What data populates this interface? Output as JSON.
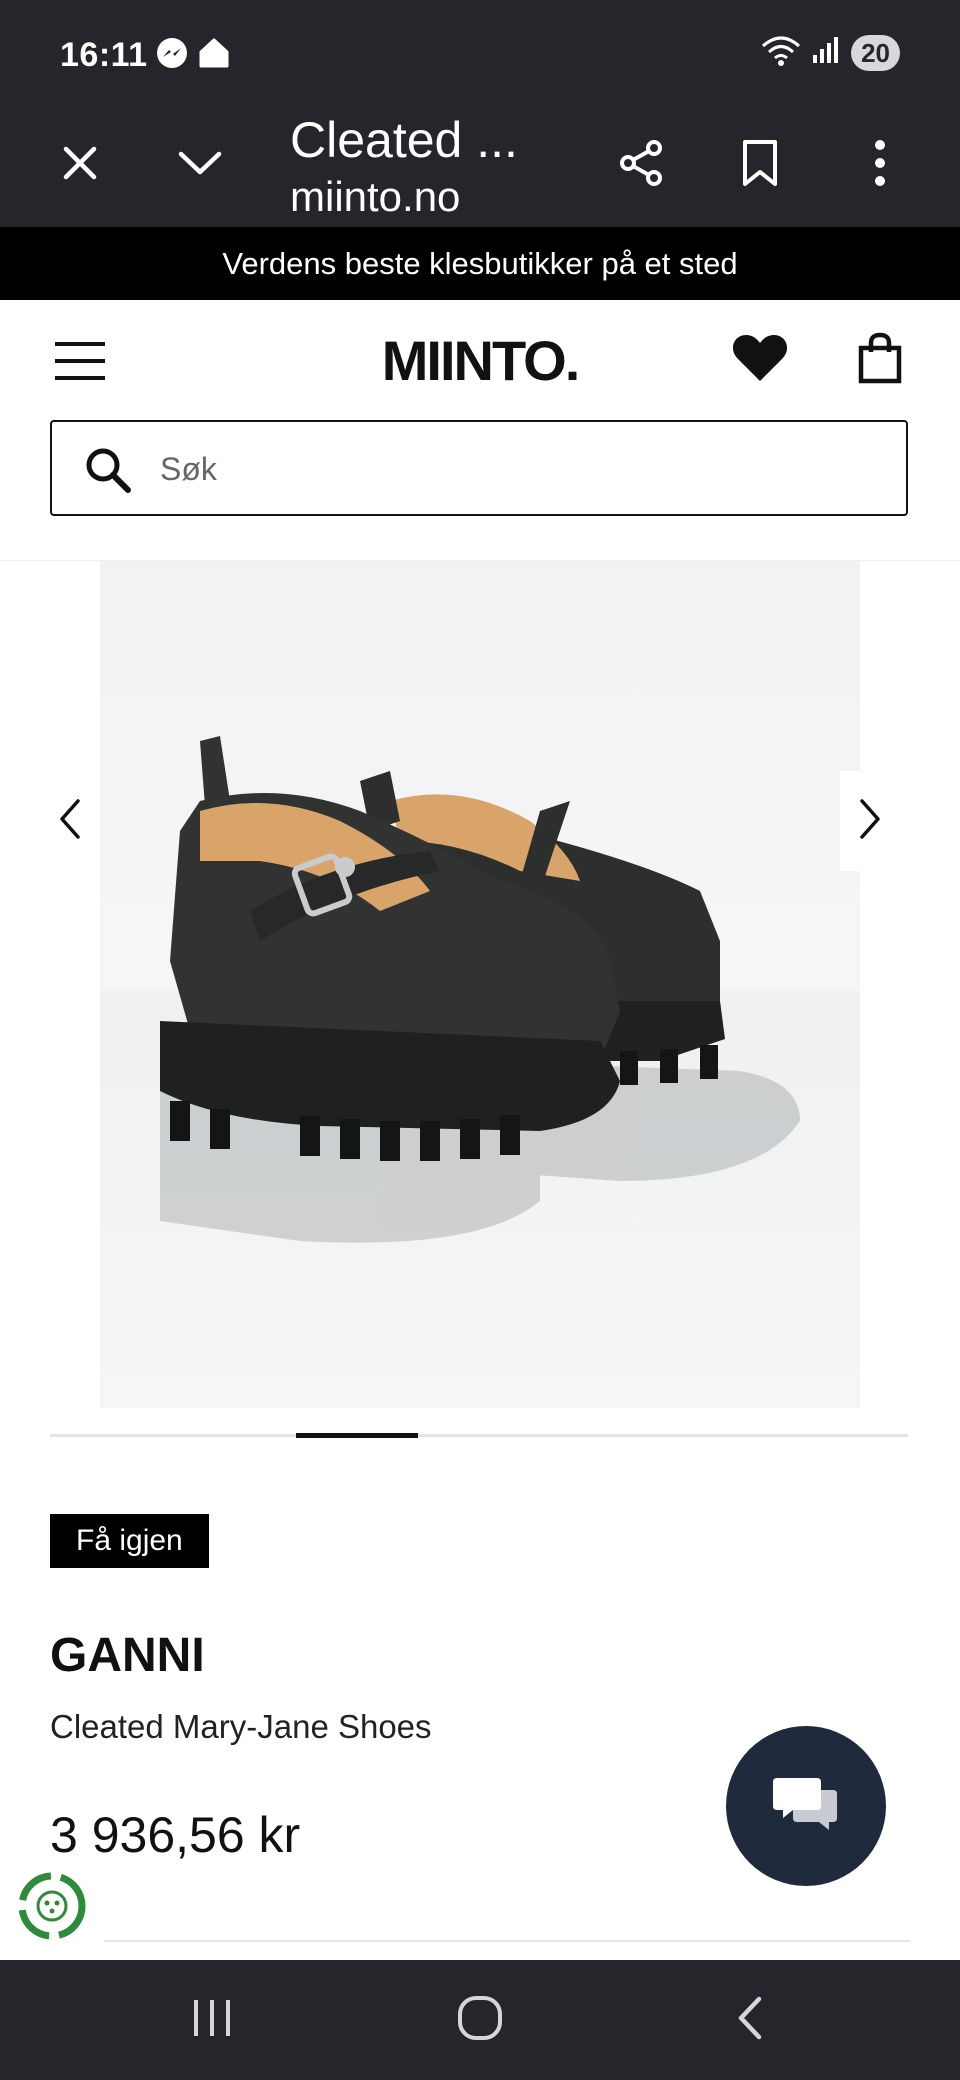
{
  "status_bar": {
    "time": "16:11",
    "battery": "20",
    "icons": [
      "messenger-icon",
      "home-app-icon",
      "wifi-icon",
      "signal-icon"
    ]
  },
  "browser": {
    "title": "Cleated ...",
    "url": "miinto.no",
    "icons": [
      "close-icon",
      "chevron-down-icon",
      "share-icon",
      "bookmark-icon",
      "more-vert-icon"
    ]
  },
  "announcement": {
    "text": "Verdens beste klesbutikker på et sted"
  },
  "header": {
    "logo": "MIINTO.",
    "search_placeholder": "Søk",
    "icons": [
      "menu-icon",
      "heart-icon",
      "shopping-bag-icon",
      "search-icon"
    ]
  },
  "gallery": {
    "image_alt": "GANNI Cleated Mary-Jane Shoes",
    "active_index": 2,
    "total_images": 6,
    "colors": {
      "shoe": "#2f3231",
      "lining": "#d9a46a",
      "background": "#f3f4f6"
    }
  },
  "product": {
    "badge": "Få igjen",
    "brand": "GANNI",
    "name": "Cleated Mary-Jane Shoes",
    "price": "3 936,56 kr"
  },
  "accent_colors": {
    "chrome": "#24262b",
    "chat_button": "#1f2a3d",
    "eco_green": "#2e8b3a"
  }
}
